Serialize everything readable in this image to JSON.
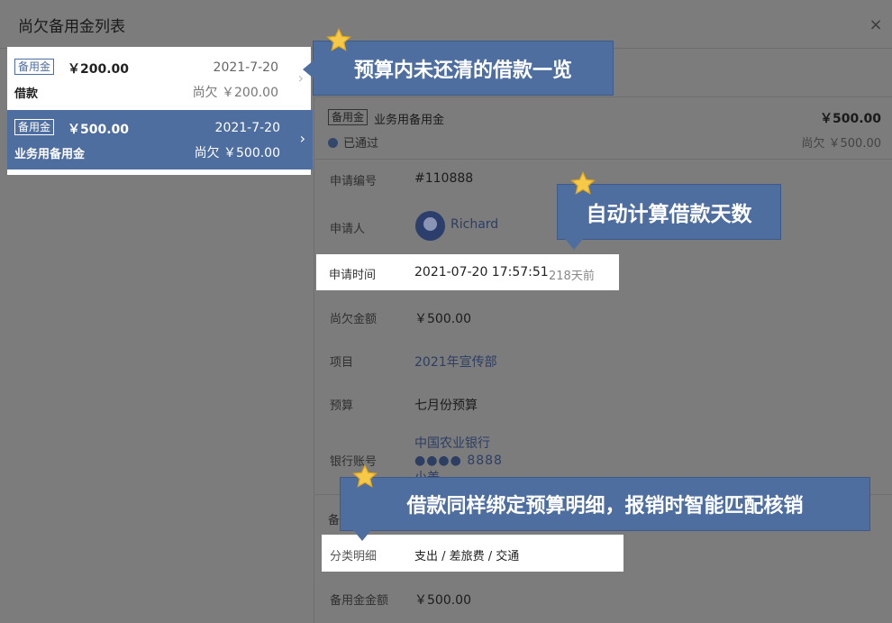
{
  "modal": {
    "title": "尚欠备用金列表",
    "close_icon": "×"
  },
  "list": [
    {
      "tag": "备用金",
      "amount": "￥200.00",
      "date": "2021-7-20",
      "name": "借款",
      "owe": "尚欠 ￥200.00",
      "chevron": "›"
    },
    {
      "tag": "备用金",
      "amount": "￥500.00",
      "date": "2021-7-20",
      "name": "业务用备用金",
      "owe": "尚欠 ￥500.00",
      "chevron": "›"
    }
  ],
  "detail": {
    "tag": "备用金",
    "name": "业务用备用金",
    "amount": "￥500.00",
    "status": "已通过",
    "owe": "尚欠 ￥500.00",
    "fields": {
      "apply_no_label": "申请编号",
      "apply_no": "#110888",
      "applicant_label": "申请人",
      "applicant": "Richard",
      "apply_time_label": "申请时间",
      "apply_time": "2021-07-20 17:57:51",
      "days_ago": "218天前",
      "owe_amount_label": "尚欠金额",
      "owe_amount": "￥500.00",
      "project_label": "项目",
      "project": "2021年宣传部",
      "budget_label": "预算",
      "budget": "七月份预算",
      "bank_label": "银行账号",
      "bank_name": "中国农业银行",
      "bank_account": "●●●● 8888",
      "bank_holder": "小美",
      "section_peek": "备",
      "category_label": "分类明细",
      "category": "支出 / 差旅费 / 交通",
      "reserve_amount_label": "备用金金额",
      "reserve_amount": "￥500.00"
    }
  },
  "callouts": {
    "c1": "预算内未还清的借款一览",
    "c2": "自动计算借款天数",
    "c3": "借款同样绑定预算明细，报销时智能匹配核销"
  },
  "colors": {
    "accent": "#4f6ea0",
    "overlay": "#7c7c7c",
    "star": "#f7c948"
  }
}
